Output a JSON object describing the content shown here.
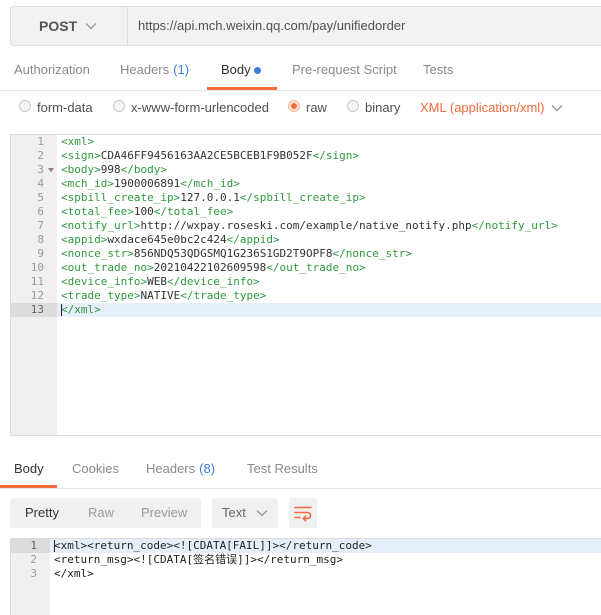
{
  "theme": {
    "accent": "#f26b3a",
    "count_color": "#3b7fe0",
    "tag_color": "#2f9a3f",
    "active_line_bg": "#e6eefa",
    "active_gutter_bg": "#dcdcdc"
  },
  "icons": {
    "method_dropdown": "chevron-down-icon",
    "content_type_dropdown": "chevron-down-icon",
    "format_dropdown": "chevron-down-icon",
    "fold": "fold-arrow-icon",
    "wrap": "wrap-lines-icon",
    "body_indicator": "dot-icon"
  },
  "request": {
    "method": "POST",
    "url": "https://api.mch.weixin.qq.com/pay/unifiedorder"
  },
  "request_tabs": [
    {
      "label": "Authorization",
      "active": false
    },
    {
      "label": "Headers",
      "count": "(1)",
      "active": false
    },
    {
      "label": "Body",
      "active": true,
      "has_content_dot": true
    },
    {
      "label": "Pre-request Script",
      "active": false
    },
    {
      "label": "Tests",
      "active": false
    }
  ],
  "body_modes": {
    "options": [
      {
        "label": "form-data",
        "selected": false
      },
      {
        "label": "x-www-form-urlencoded",
        "selected": false
      },
      {
        "label": "raw",
        "selected": true
      },
      {
        "label": "binary",
        "selected": false
      }
    ],
    "content_type": "XML (application/xml)"
  },
  "request_editor": {
    "active_line": 13,
    "lines": [
      {
        "n": "1",
        "text": "<xml>"
      },
      {
        "n": "2",
        "text": "<sign>CDA46FF9456163AA2CE5BCEB1F9B052F</sign>"
      },
      {
        "n": "3",
        "text": "<body>998</body>"
      },
      {
        "n": "4",
        "text": "<mch_id>1900006891</mch_id>"
      },
      {
        "n": "5",
        "text": "<spbill_create_ip>127.0.0.1</spbill_create_ip>"
      },
      {
        "n": "6",
        "text": "<total_fee>100</total_fee>"
      },
      {
        "n": "7",
        "text": "<notify_url>http://wxpay.roseski.com/example/native_notify.php</notify_url>"
      },
      {
        "n": "8",
        "text": "<appid>wxdace645e0bc2c424</appid>"
      },
      {
        "n": "9",
        "text": "<nonce_str>856NDQ53QDGSMQ1G236S1GD2T9OPF8</nonce_str>"
      },
      {
        "n": "10",
        "text": "<out_trade_no>20210422102609598</out_trade_no>"
      },
      {
        "n": "11",
        "text": "<device_info>WEB</device_info>"
      },
      {
        "n": "12",
        "text": "<trade_type>NATIVE</trade_type>"
      },
      {
        "n": "13",
        "text": "</xml>"
      }
    ]
  },
  "response_tabs": [
    {
      "label": "Body",
      "active": true
    },
    {
      "label": "Cookies",
      "active": false
    },
    {
      "label": "Headers",
      "count": "(8)",
      "active": false
    },
    {
      "label": "Test Results",
      "active": false
    }
  ],
  "response_toolbar": {
    "views": [
      {
        "label": "Pretty",
        "active": true
      },
      {
        "label": "Raw",
        "active": false
      },
      {
        "label": "Preview",
        "active": false
      }
    ],
    "format": "Text"
  },
  "response_editor": {
    "active_line": 1,
    "lines": [
      {
        "n": "1",
        "text": "<xml><return_code><![CDATA[FAIL]]></return_code>"
      },
      {
        "n": "2",
        "text": "<return_msg><![CDATA[签名错误]]></return_msg>"
      },
      {
        "n": "3",
        "text": "</xml>"
      }
    ]
  }
}
